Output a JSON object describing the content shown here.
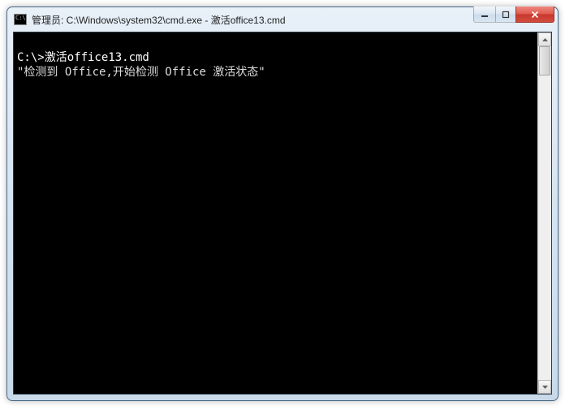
{
  "window": {
    "title": "管理员: C:\\Windows\\system32\\cmd.exe - 激活office13.cmd"
  },
  "console": {
    "blank_top": "",
    "prompt_line": "C:\\>激活office13.cmd",
    "output_line": "\"检测到 Office,开始检测 Office 激活状态\""
  }
}
